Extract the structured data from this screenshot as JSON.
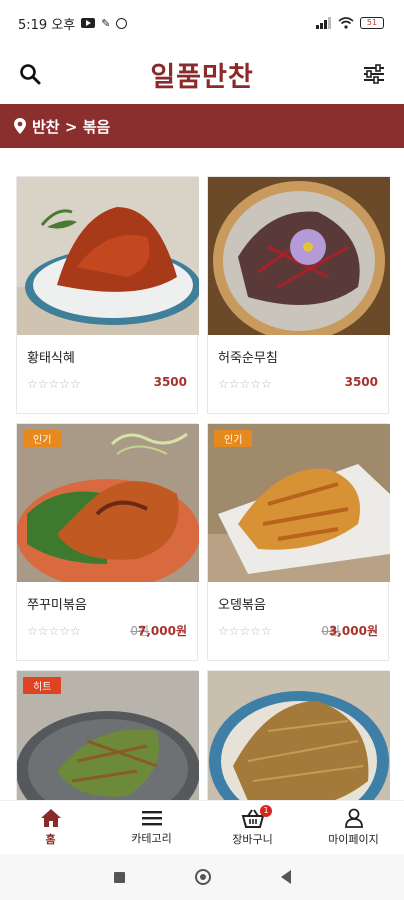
{
  "status_bar": {
    "time": "5:19 오후",
    "battery": "51"
  },
  "header": {
    "title": "일품만찬"
  },
  "breadcrumb": {
    "text": "반찬 > 볶음"
  },
  "products": [
    {
      "name": "황태식혜",
      "orig_price": "",
      "price": "3500",
      "badge": "",
      "stars": "☆☆☆☆☆"
    },
    {
      "name": "허죽순무침",
      "orig_price": "",
      "price": "3500",
      "badge": "",
      "stars": "☆☆☆☆☆"
    },
    {
      "name": "쭈꾸미볶음",
      "orig_price": "0원",
      "price": "7,000원",
      "badge": "인기",
      "stars": "☆☆☆☆☆"
    },
    {
      "name": "오뎅볶음",
      "orig_price": "0원",
      "price": "3,000원",
      "badge": "인기",
      "stars": "☆☆☆☆☆"
    },
    {
      "name": "",
      "orig_price": "",
      "price": "",
      "badge": "히트",
      "stars": ""
    },
    {
      "name": "",
      "orig_price": "",
      "price": "",
      "badge": "",
      "stars": ""
    }
  ],
  "bottom_nav": {
    "home": "홈",
    "category": "카테고리",
    "cart": "장바구니",
    "cart_count": "1",
    "mypage": "마이페이지"
  },
  "colors": {
    "brand": "#8b2e2e",
    "price": "#a8322a",
    "badge_popular": "#e6891e",
    "badge_hit": "#e0431f"
  },
  "icons": [
    "search-icon",
    "filter-icon",
    "location-pin-icon",
    "home-icon",
    "menu-icon",
    "cart-icon",
    "user-icon"
  ]
}
